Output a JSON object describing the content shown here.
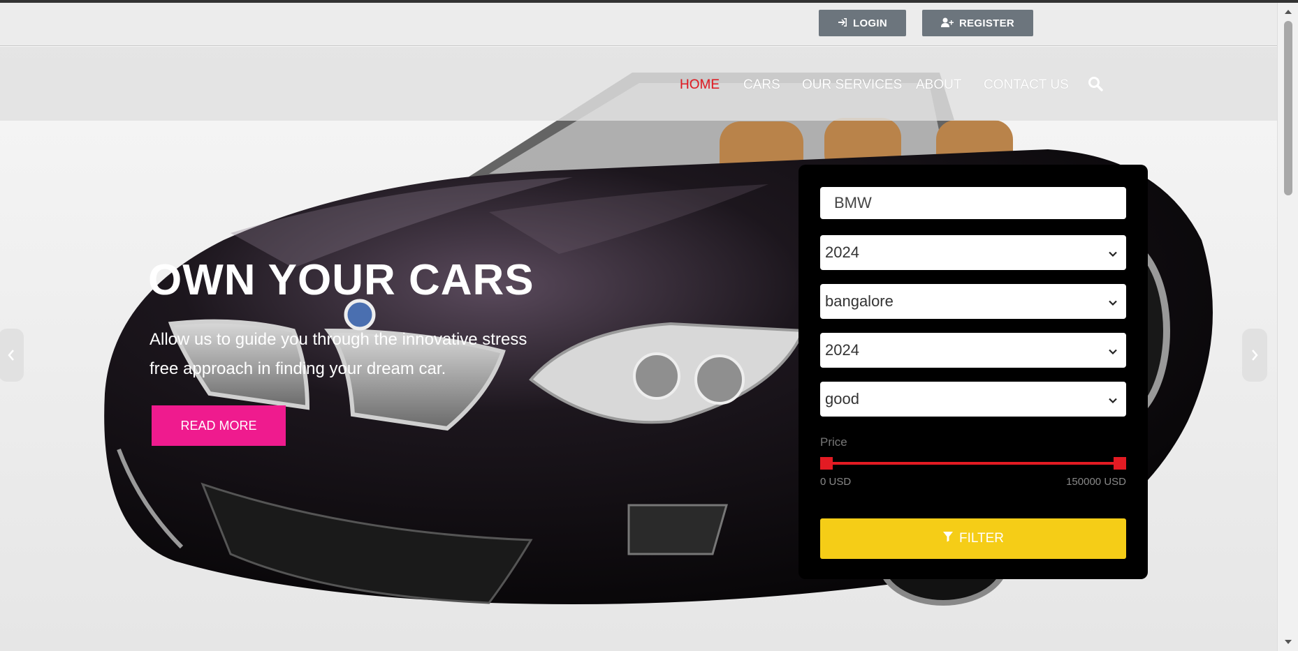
{
  "topbar": {
    "login_label": "LOGIN",
    "register_label": "REGISTER"
  },
  "nav": {
    "items": [
      {
        "label": "HOME",
        "active": true
      },
      {
        "label": "CARS",
        "active": false
      },
      {
        "label": "OUR SERVICES",
        "active": false
      },
      {
        "label": "ABOUT",
        "active": false
      },
      {
        "label": "CONTACT US",
        "active": false
      }
    ]
  },
  "hero": {
    "title": "OWN YOUR CARS",
    "subtitle": "Allow us to guide you through the innovative stress free approach in finding your dream car.",
    "cta_label": "READ MORE"
  },
  "filter": {
    "brand_value": "BMW",
    "year_value": "2024",
    "city_value": "bangalore",
    "year2_value": "2024",
    "condition_value": "good",
    "price_label": "Price",
    "price_min_label": "0 USD",
    "price_max_label": "150000 USD",
    "button_label": "FILTER"
  },
  "colors": {
    "accent_red": "#e31b23",
    "cta_pink": "#ef1b8e",
    "filter_yellow": "#f5cd17",
    "topbar_button": "#6c757d"
  }
}
